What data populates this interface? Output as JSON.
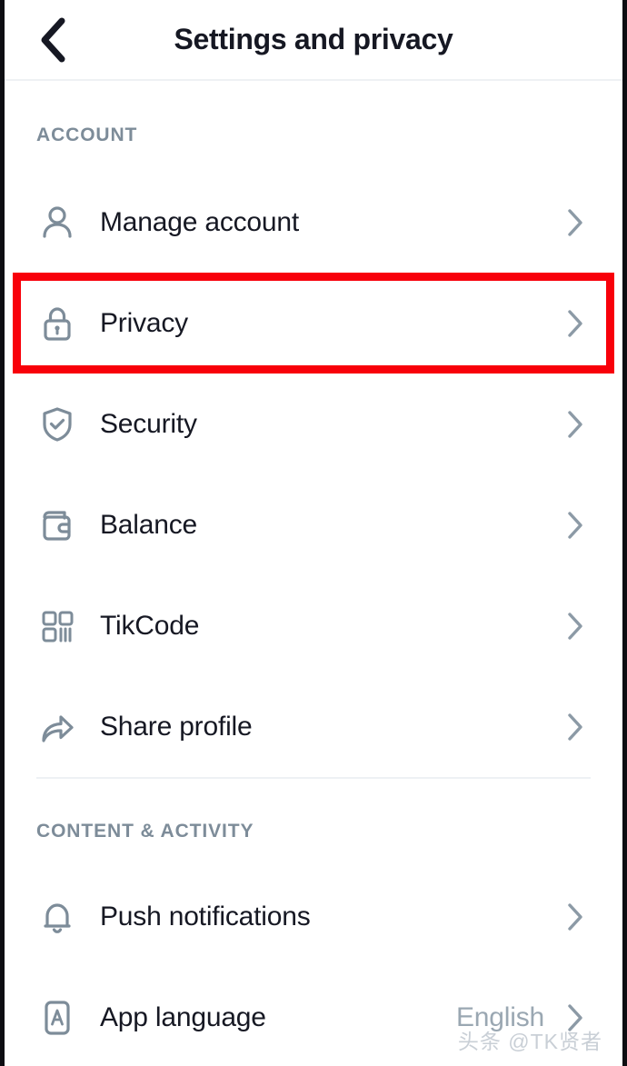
{
  "header": {
    "title": "Settings and privacy",
    "back_icon": "chevron-left-icon"
  },
  "sections": [
    {
      "label": "ACCOUNT",
      "items": [
        {
          "label": "Manage account",
          "icon": "person-icon",
          "value": "",
          "chevron": "chevron-right-icon",
          "highlighted": false
        },
        {
          "label": "Privacy",
          "icon": "lock-icon",
          "value": "",
          "chevron": "chevron-right-icon",
          "highlighted": true
        },
        {
          "label": "Security",
          "icon": "shield-check-icon",
          "value": "",
          "chevron": "chevron-right-icon",
          "highlighted": false
        },
        {
          "label": "Balance",
          "icon": "wallet-icon",
          "value": "",
          "chevron": "chevron-right-icon",
          "highlighted": false
        },
        {
          "label": "TikCode",
          "icon": "qr-code-icon",
          "value": "",
          "chevron": "chevron-right-icon",
          "highlighted": false
        },
        {
          "label": "Share profile",
          "icon": "share-arrow-icon",
          "value": "",
          "chevron": "chevron-right-icon",
          "highlighted": false
        }
      ]
    },
    {
      "label": "CONTENT & ACTIVITY",
      "items": [
        {
          "label": "Push notifications",
          "icon": "bell-icon",
          "value": "",
          "chevron": "chevron-right-icon",
          "highlighted": false
        },
        {
          "label": "App language",
          "icon": "letter-a-icon",
          "value": "English",
          "chevron": "chevron-right-icon",
          "highlighted": false
        }
      ]
    }
  ],
  "watermark": {
    "text": "头条 @TK贤者"
  },
  "colors": {
    "text_primary": "#161823",
    "text_muted": "#7d8c99",
    "value_text": "#9aa7b2",
    "icon_stroke": "#7d8c99",
    "divider": "#eef1f4",
    "highlight": "#f8000a",
    "background": "#ffffff"
  }
}
